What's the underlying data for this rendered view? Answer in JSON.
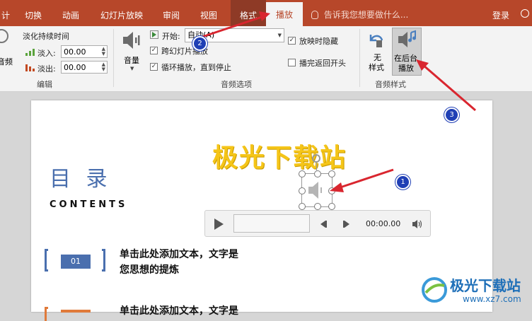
{
  "tabs": [
    {
      "label": "计",
      "active": false
    },
    {
      "label": "切换",
      "active": false
    },
    {
      "label": "动画",
      "active": false
    },
    {
      "label": "幻灯片放映",
      "active": false
    },
    {
      "label": "审阅",
      "active": false
    },
    {
      "label": "视图",
      "active": false
    },
    {
      "label": "格式",
      "active": false
    },
    {
      "label": "播放",
      "active": true
    }
  ],
  "tell_me": "告诉我您想要做什么...",
  "login": "登录",
  "ribbon": {
    "edit": {
      "audio_label": "音频",
      "fade_duration": "淡化持续时间",
      "fade_in_label": "淡入:",
      "fade_in_value": "00.00",
      "fade_out_label": "淡出:",
      "fade_out_value": "00.00",
      "group_label": "编辑"
    },
    "audio_options": {
      "volume_label": "音量",
      "start_label": "开始:",
      "start_value": "自动(A)",
      "play_across_slides": "跨幻灯片播放",
      "loop": "循环播放，直到停止",
      "hide_during_show": "放映时隐藏",
      "rewind": "播完返回开头",
      "group_label": "音频选项",
      "play_across_checked": true,
      "loop_checked": true,
      "hide_checked": true,
      "rewind_checked": false
    },
    "audio_styles": {
      "no_style_line1": "无",
      "no_style_line2": "样式",
      "bg_play_line1": "在后台",
      "bg_play_line2": "播放",
      "group_label": "音频样式"
    }
  },
  "slide": {
    "title_watermark": "极光下载站",
    "heading": "目 录",
    "subheading": "CONTENTS",
    "item1_number": "01",
    "item1_text_line1": "单击此处添加文本，文字是",
    "item1_text_line2": "您思想的提炼",
    "item2_text_line1": "单击此处添加文本，文字是"
  },
  "player": {
    "time": "00:00.00"
  },
  "annotations": {
    "badge1": "1",
    "badge2": "2",
    "badge3": "3"
  },
  "watermark": {
    "site_name": "极光下载站",
    "site_url": "www.xz7.com"
  },
  "colors": {
    "ribbon_red": "#b7472a",
    "arrow_red": "#d9262f",
    "heading_blue": "#4a6fae",
    "orange": "#e07a3a",
    "gold": "#f5c518"
  }
}
